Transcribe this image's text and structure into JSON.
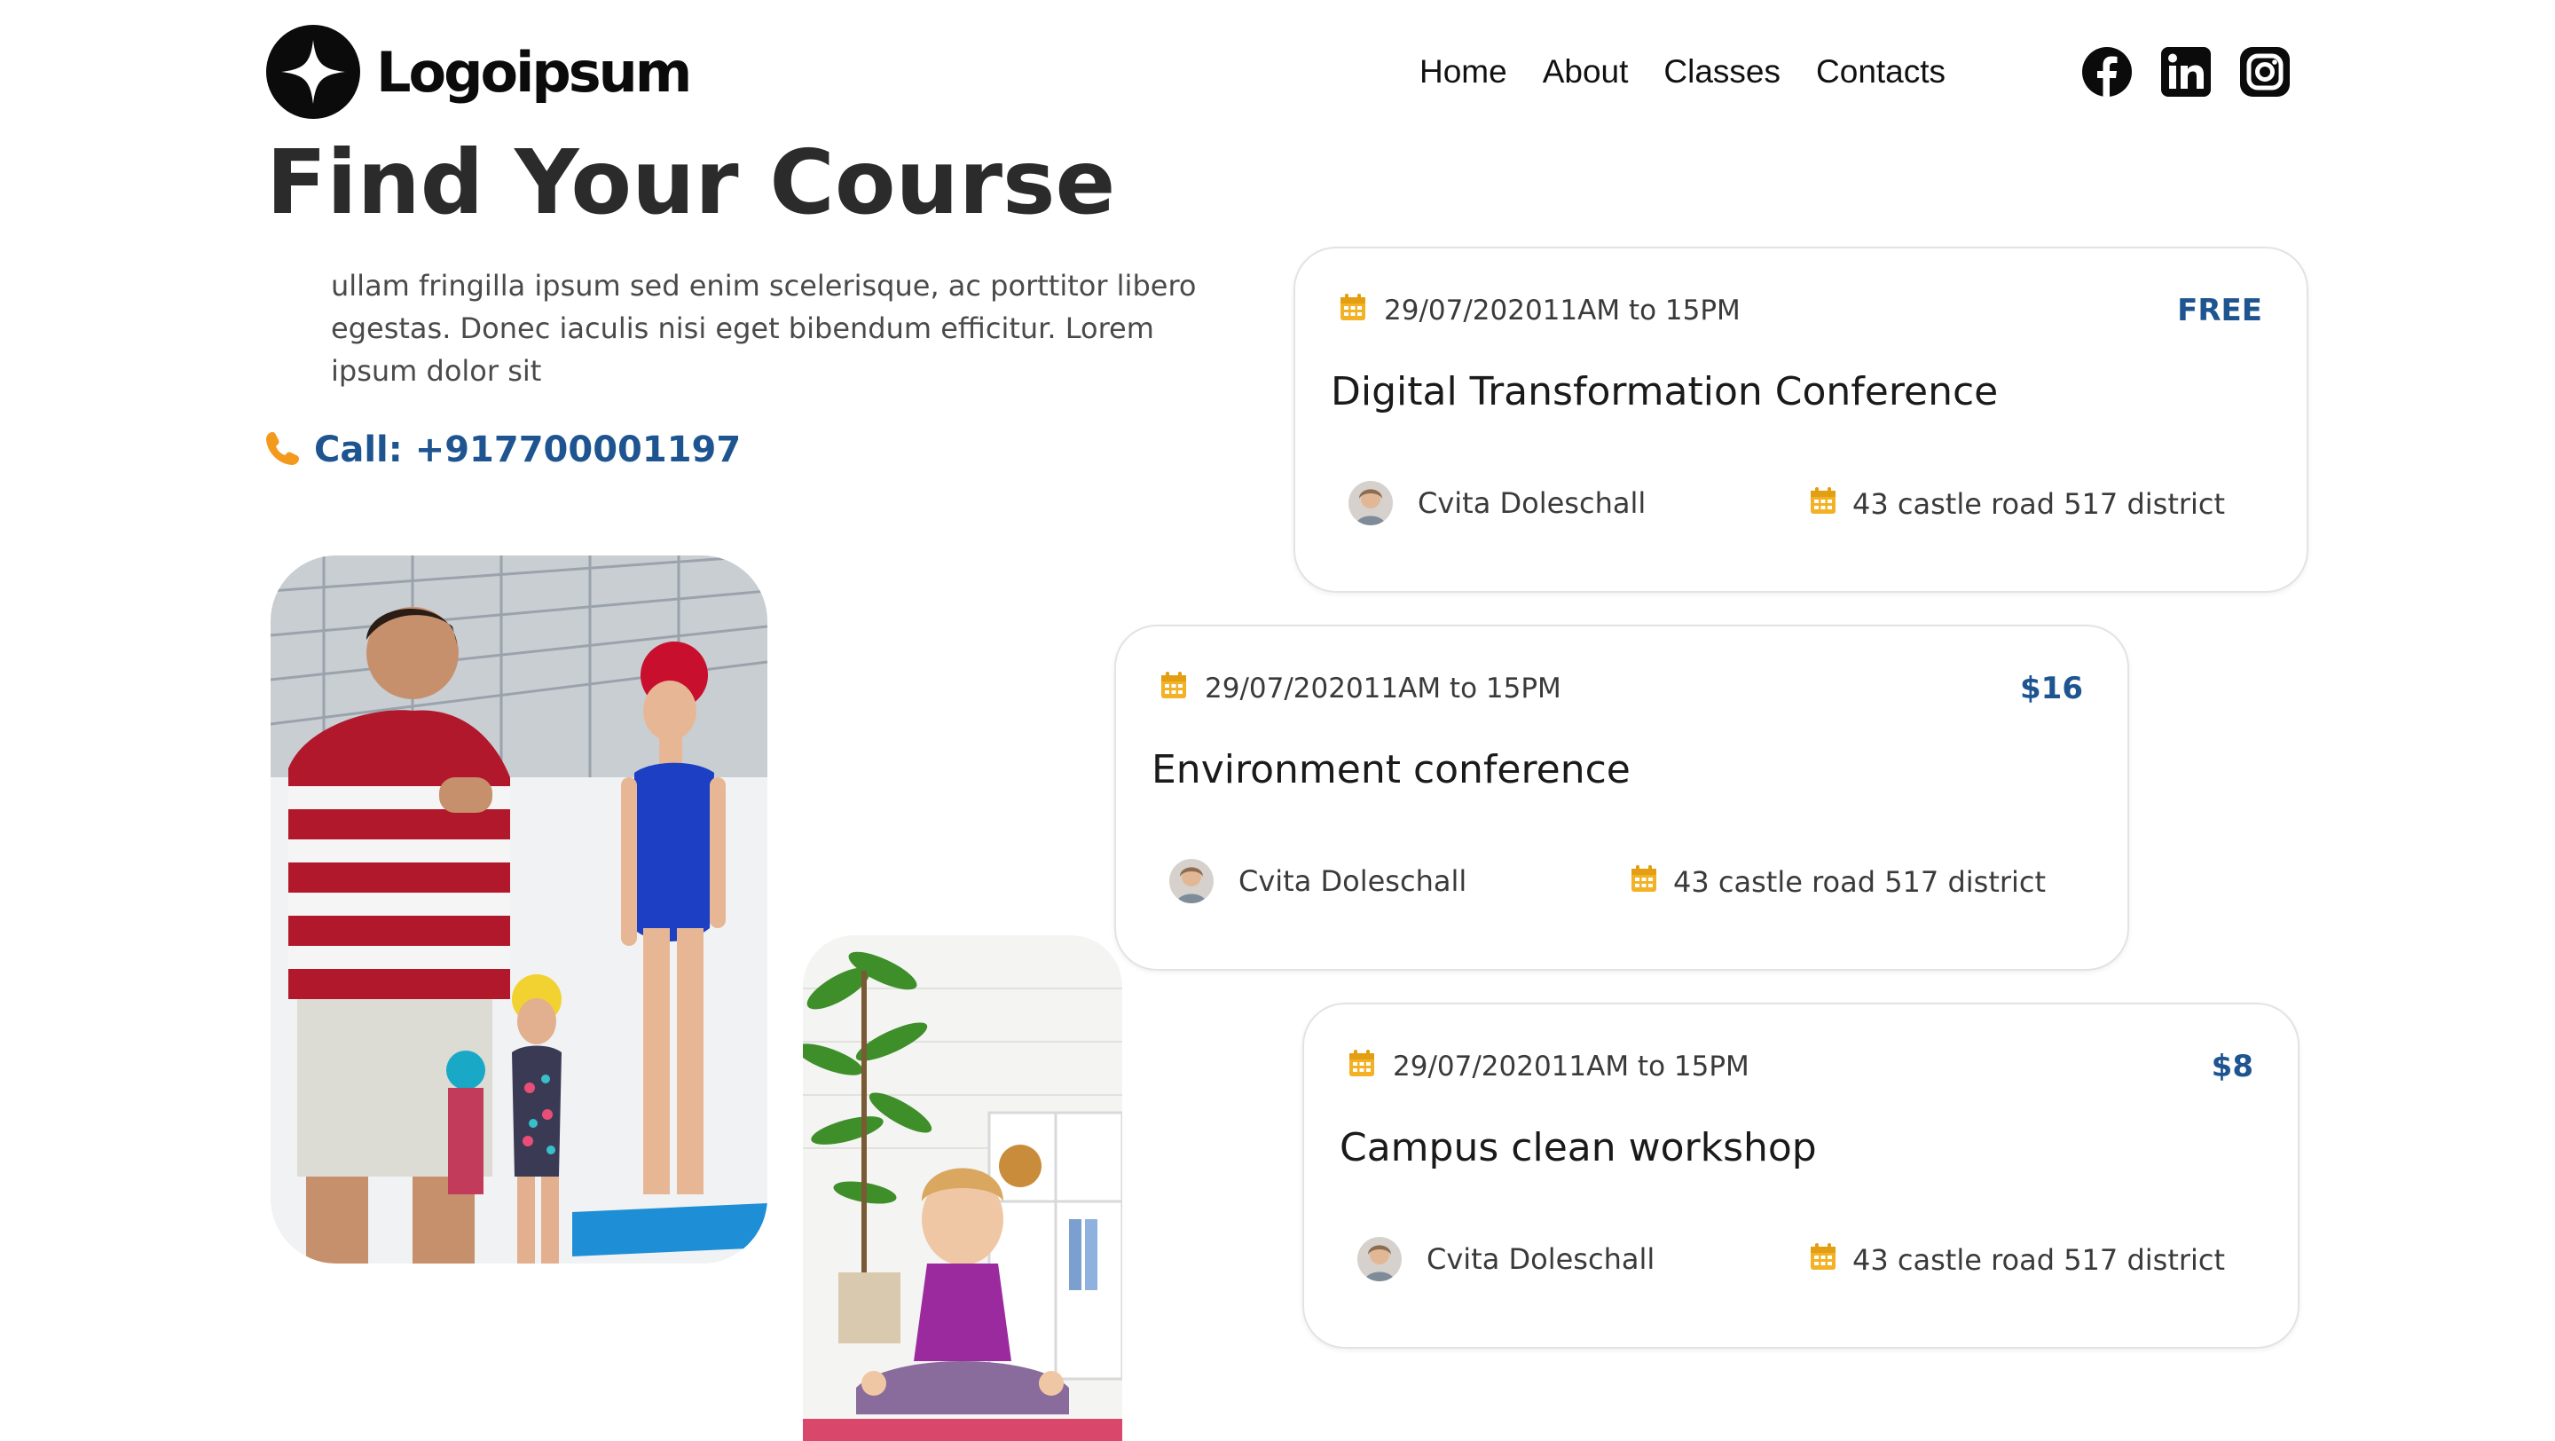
{
  "header": {
    "logo_text": "Logoipsum",
    "nav": [
      "Home",
      "About",
      "Classes",
      "Contacts"
    ],
    "social": [
      {
        "name": "facebook",
        "icon": "facebook-icon"
      },
      {
        "name": "linkedin",
        "icon": "linkedin-icon"
      },
      {
        "name": "instagram",
        "icon": "instagram-icon"
      }
    ]
  },
  "hero": {
    "title": "Find Your Course",
    "intro": "ullam fringilla ipsum sed enim scelerisque, ac porttitor libero egestas. Donec iaculis nisi eget bibendum efficitur. Lorem ipsum dolor sit",
    "call_label": "Call: +917700001197"
  },
  "events": [
    {
      "date": "29/07/202011AM to 15PM",
      "price": "FREE",
      "name": "Digital Transformation Conference",
      "host": "Cvita Doleschall",
      "location": "43 castle road 517 district"
    },
    {
      "date": "29/07/202011AM to 15PM",
      "price": "$16",
      "name": "Environment conference",
      "host": "Cvita Doleschall",
      "location": "43 castle road 517 district"
    },
    {
      "date": "29/07/202011AM to 15PM",
      "price": "$8",
      "name": "Campus clean workshop",
      "host": "Cvita Doleschall",
      "location": "43 castle road 517 district"
    }
  ],
  "colors": {
    "accent": "#1e5591",
    "calendar_icon": "#f3b125",
    "phone_icon": "#f39a1d",
    "text": "#2b2b2b"
  }
}
